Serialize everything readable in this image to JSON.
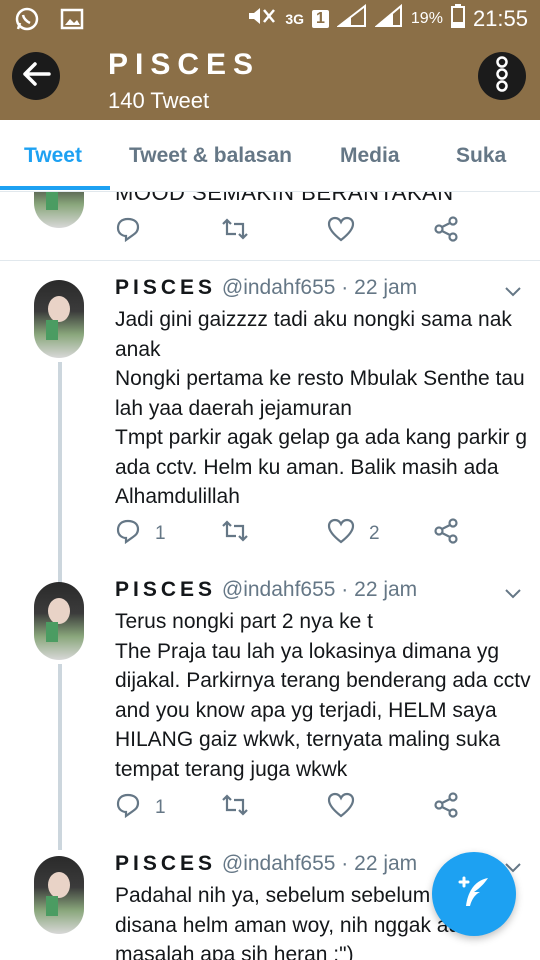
{
  "status_bar": {
    "network": "3G",
    "sim": "1",
    "battery": "19%",
    "time": "21:55"
  },
  "header": {
    "title": "PISCES",
    "subtitle": "140 Tweet"
  },
  "tabs": [
    {
      "label": "Tweet",
      "active": true
    },
    {
      "label": "Tweet & balasan",
      "active": false
    },
    {
      "label": "Media",
      "active": false
    },
    {
      "label": "Suka",
      "active": false
    }
  ],
  "clipped_tweet": {
    "text": "MOOD SEMAKIN BERANTAKAN"
  },
  "tweets": [
    {
      "name": "PISCES",
      "handle": "@indahf655",
      "time": "22 jam",
      "text": "Jadi gini gaizzzz tadi aku nongki sama nak anak\nNongki pertama ke resto Mbulak Senthe tau lah yaa daerah jejamuran\nTmpt parkir agak gelap ga ada kang parkir g ada cctv. Helm ku aman. Balik masih ada Alhamdulillah",
      "replies": "1",
      "likes": "2"
    },
    {
      "name": "PISCES",
      "handle": "@indahf655",
      "time": "22 jam",
      "text": "Terus nongki part 2 nya ke t\nThe Praja tau lah ya lokasinya dimana yg dijakal. Parkirnya terang benderang ada cctv and you know apa yg terjadi, HELM saya HILANG gaiz wkwk, ternyata maling suka tempat terang juga wkwk",
      "replies": "1",
      "likes": ""
    },
    {
      "name": "PISCES",
      "handle": "@indahf655",
      "time": "22 jam",
      "text": "Padahal nih ya, sebelum sebelum nongki disana helm aman woy, nih nggak ada masalah apa sih heran :\")"
    }
  ],
  "colors": {
    "header_bg": "#8b6f47",
    "accent": "#1da1f2",
    "muted": "#657786"
  }
}
